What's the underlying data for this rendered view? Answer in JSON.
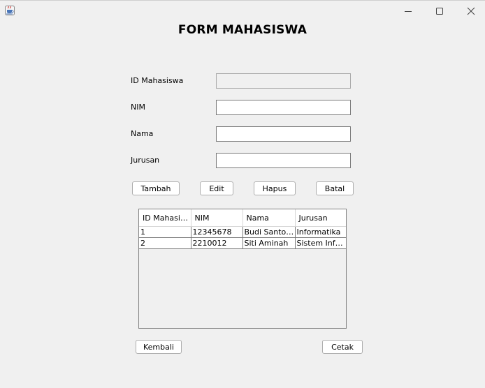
{
  "form": {
    "title": "FORM MAHASISWA",
    "fields": [
      {
        "label": "ID Mahasiswa",
        "value": "",
        "enabled": false
      },
      {
        "label": "NIM",
        "value": "",
        "enabled": true
      },
      {
        "label": "Nama",
        "value": "",
        "enabled": true
      },
      {
        "label": "Jurusan",
        "value": "",
        "enabled": true
      }
    ],
    "buttons": {
      "tambah": "Tambah",
      "edit": "Edit",
      "hapus": "Hapus",
      "batal": "Batal",
      "kembali": "Kembali",
      "cetak": "Cetak"
    }
  },
  "table": {
    "headers": [
      "ID Mahasis...",
      "NIM",
      "Nama",
      "Jurusan"
    ],
    "rows": [
      [
        "1",
        "12345678",
        "Budi Santoso",
        "Informatika"
      ],
      [
        "2",
        "2210012",
        "Siti Aminah",
        "Sistem Infor..."
      ]
    ]
  },
  "window": {
    "icon": "java-app-icon",
    "controls": [
      "minimize-icon",
      "maximize-icon",
      "close-icon"
    ]
  }
}
